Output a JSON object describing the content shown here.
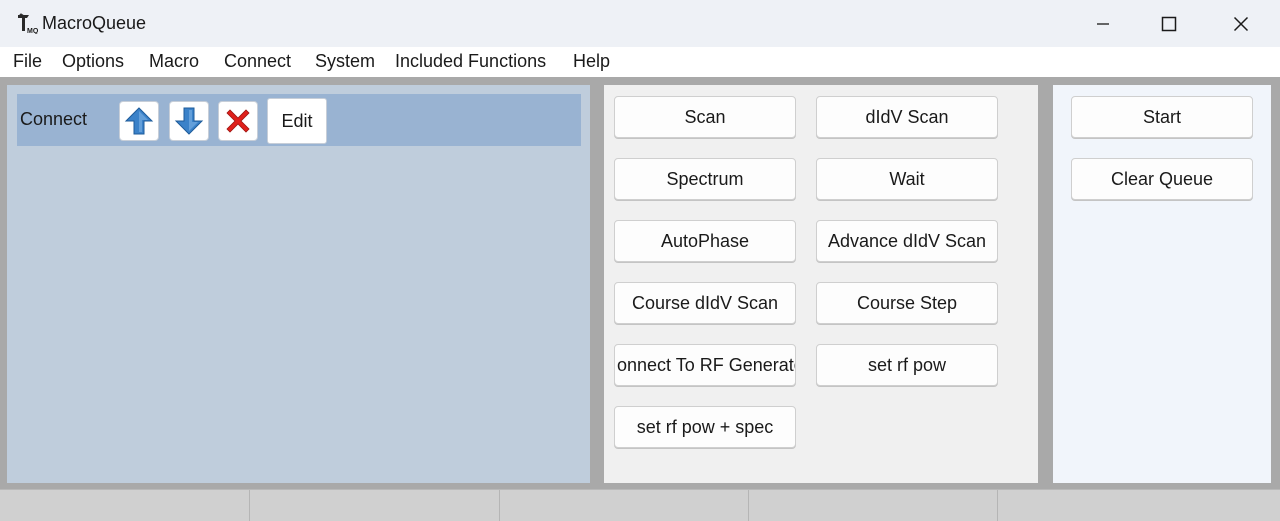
{
  "window": {
    "title": "MacroQueue",
    "icon_label": "MQ"
  },
  "menu": {
    "items": [
      "File",
      "Options",
      "Macro",
      "Connect",
      "System",
      "Included Functions",
      "Help"
    ]
  },
  "queue": {
    "items": [
      {
        "label": "Connect",
        "edit_label": "Edit"
      }
    ]
  },
  "macros": {
    "buttons": [
      "Scan",
      "dIdV Scan",
      "Spectrum",
      "Wait",
      "AutoPhase",
      "Advance dIdV Scan",
      "Course dIdV Scan",
      "Course Step",
      "onnect To RF Generato",
      "set rf pow",
      "set rf pow + spec"
    ]
  },
  "controls": {
    "start_label": "Start",
    "clear_label": "Clear Queue"
  },
  "colors": {
    "queue_background": "#bfcddc",
    "queue_item_background": "#99b3d2",
    "arrow_blue": "#3b82c9",
    "delete_red": "#e0201b"
  }
}
